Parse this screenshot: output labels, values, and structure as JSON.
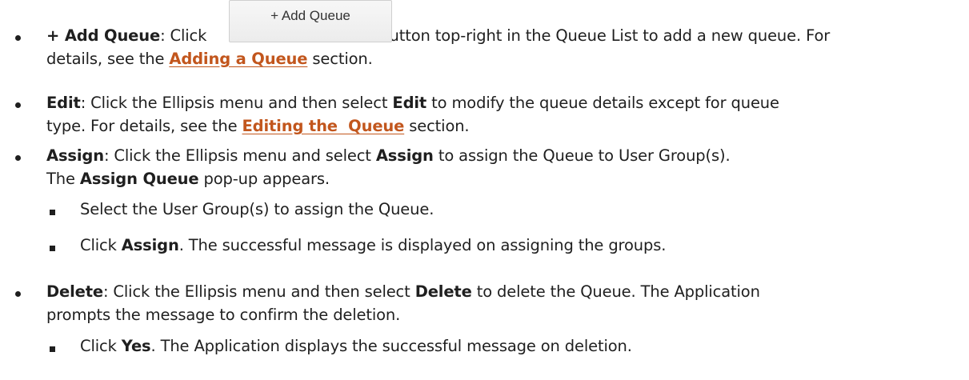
{
  "button": {
    "label": "+ Add Queue"
  },
  "items": [
    {
      "term": "+ Add Queue",
      "sep": ": Click",
      "text_after_button": "button top-right in the Queue List to add a new queue. For",
      "line2_pre": "details, see the ",
      "link": "Adding a Queue",
      "line2_post": " section."
    },
    {
      "term": "Edit",
      "sep": ": Click the Ellipsis menu and then select ",
      "bold2": "Edit",
      "rest": " to modify the queue details except for queue",
      "line2_pre": "type. For details, see the ",
      "link": "Editing the  Queue",
      "line2_post": " section."
    },
    {
      "term": "Assign",
      "sep": ": Click the Ellipsis menu and select ",
      "bold2": "Assign",
      "rest": " to assign the Queue to User Group(s).",
      "line2_pre": "The ",
      "bold3": "Assign Queue",
      "line2_post": " pop-up appears."
    },
    {
      "term": "Delete",
      "sep": ": Click the Ellipsis menu and then select ",
      "bold2": "Delete",
      "rest": " to delete the Queue. The Application",
      "line2": "prompts the message to confirm the deletion."
    }
  ],
  "sub_items": [
    {
      "text": "Select the User Group(s) to assign the Queue."
    },
    {
      "pre": "Click ",
      "bold": "Assign",
      "post": ". The successful message is displayed on assigning the groups."
    },
    {
      "pre": "Click ",
      "bold": "Yes",
      "post": ". The Application displays the successful message on deletion."
    }
  ]
}
